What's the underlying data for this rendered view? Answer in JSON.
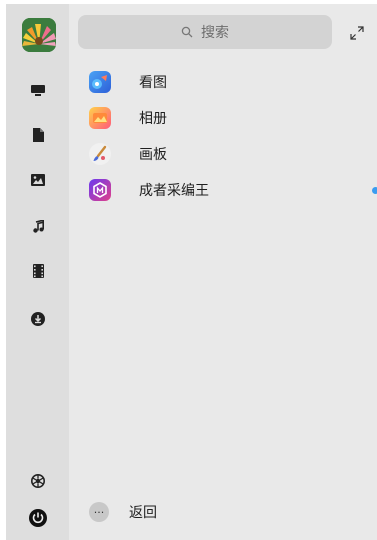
{
  "search": {
    "placeholder": "搜索",
    "icon": "search-icon"
  },
  "header": {
    "expand_icon": "expand-icon"
  },
  "sidebar": {
    "avatar": "user-avatar",
    "items": [
      {
        "name": "computer",
        "icon": "computer-icon"
      },
      {
        "name": "documents",
        "icon": "document-icon"
      },
      {
        "name": "pictures",
        "icon": "image-icon"
      },
      {
        "name": "music",
        "icon": "music-note-icon"
      },
      {
        "name": "videos",
        "icon": "film-icon"
      },
      {
        "name": "downloads",
        "icon": "download-icon"
      }
    ],
    "bottom": [
      {
        "name": "settings",
        "icon": "settings-icon"
      },
      {
        "name": "power",
        "icon": "power-icon"
      }
    ]
  },
  "apps": [
    {
      "label": "看图",
      "icon": "image-viewer-icon"
    },
    {
      "label": "相册",
      "icon": "album-icon"
    },
    {
      "label": "画板",
      "icon": "paint-brush-icon"
    },
    {
      "label": "成者采编王",
      "icon": "editor-app-icon",
      "new": true
    }
  ],
  "footer": {
    "back_label": "返回",
    "more_icon": "more-icon",
    "more_glyph": "···"
  },
  "colors": {
    "sidebar_bg": "#dedede",
    "main_bg": "#e9e9e9",
    "search_bg": "#d3d3d3",
    "new_dot": "#3b9cf0"
  }
}
